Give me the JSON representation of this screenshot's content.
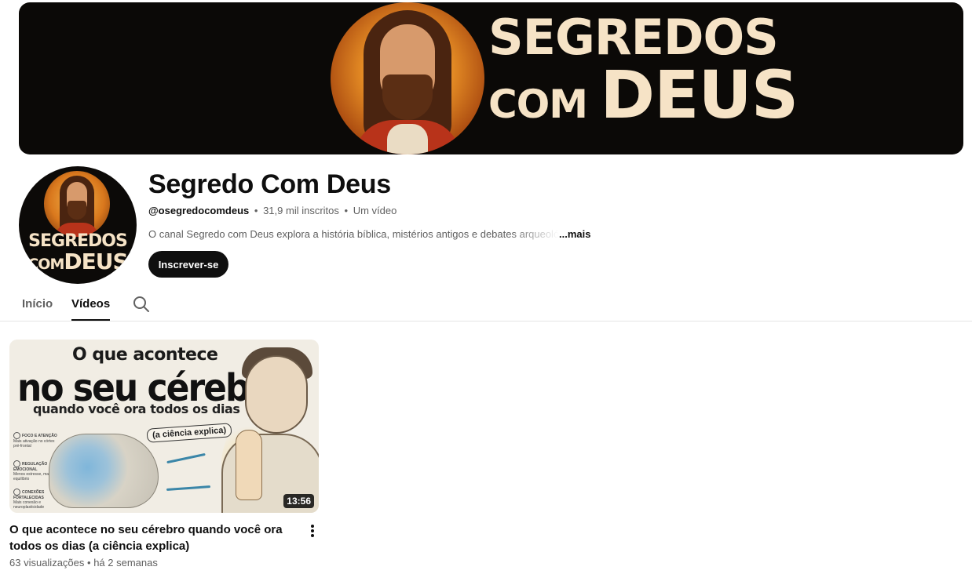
{
  "banner": {
    "title_line1": "SEGREDOS",
    "title_line2_small": "COM",
    "title_line2_big": "DEUS"
  },
  "avatar": {
    "line1": "SEGREDOS",
    "line2_small": "COM",
    "line2_big": "DEUS"
  },
  "channel": {
    "name": "Segredo Com Deus",
    "handle": "@osegredocomdeus",
    "separator": "•",
    "subscribers": "31,9 mil inscritos",
    "video_count": "Um vídeo",
    "description": "O canal Segredo com Deus explora a história bíblica, mistérios antigos e debates arqueológicos",
    "more_label": "...mais",
    "subscribe_label": "Inscrever-se"
  },
  "tabs": [
    {
      "label": "Início",
      "active": false
    },
    {
      "label": "Vídeos",
      "active": true
    }
  ],
  "video": {
    "thumbnail": {
      "line1": "O que acontece",
      "line2": "no seu cérebro",
      "line3": "quando você ora todos os dias",
      "tag": "(a ciência explica)",
      "side_items": [
        {
          "title": "FOCO E ATENÇÃO",
          "sub": "Mais ativação no córtex pré-frontal"
        },
        {
          "title": "REGULAÇÃO EMOCIONAL",
          "sub": "Menos estresse, mais equilíbrio"
        },
        {
          "title": "CONEXÕES FORTALECIDAS",
          "sub": "Mais conexão e neuroplasticidade"
        }
      ]
    },
    "duration": "13:56",
    "title": "O que acontece no seu cérebro quando você ora todos os dias (a ciência explica)",
    "views": "63 visualizações",
    "age": "há 2 semanas"
  },
  "colors": {
    "text_primary": "#0f0f0f",
    "text_secondary": "#606060",
    "banner_bg": "#0b0907",
    "banner_text": "#f6e3c6",
    "button_bg": "#0f0f0f"
  },
  "icons": [
    "search-icon",
    "more-vert-icon"
  ]
}
